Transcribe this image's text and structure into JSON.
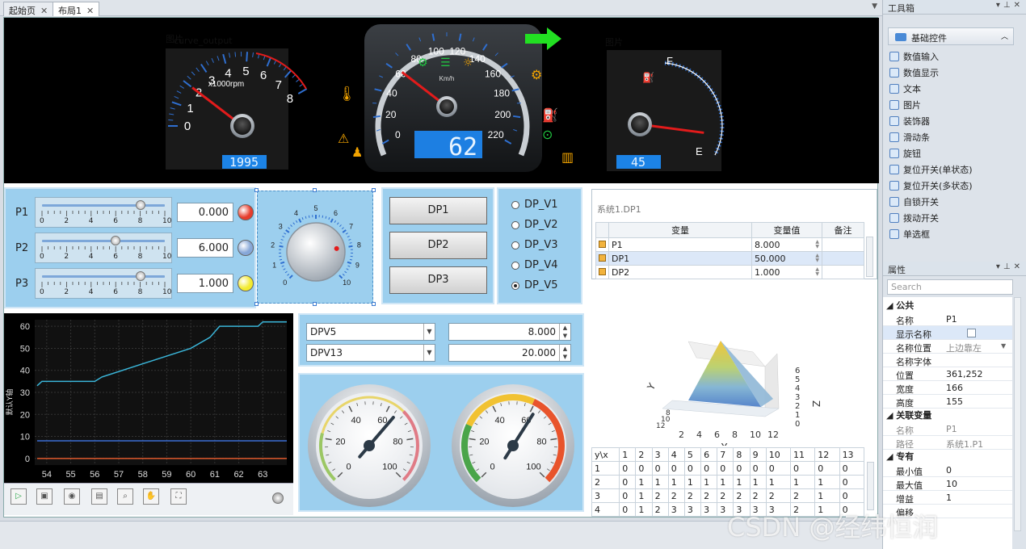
{
  "tabs": [
    {
      "label": "起始页",
      "active": false
    },
    {
      "label": "布局1",
      "active": true
    }
  ],
  "dashboard": {
    "tacho": {
      "title": "图片",
      "title2": "curve_output",
      "unit": "x1000rpm",
      "ticks": [
        "0",
        "1",
        "2",
        "3",
        "4",
        "5",
        "6",
        "7",
        "8"
      ],
      "digital": "1995",
      "needle_value": 2.0
    },
    "speedo": {
      "unit": "Km/h",
      "ticks": [
        "0",
        "20",
        "40",
        "60",
        "80",
        "100",
        "120",
        "140",
        "160",
        "180",
        "200",
        "220"
      ],
      "digital": "62",
      "needle_value": 62
    },
    "fuel": {
      "title": "图片",
      "full_label": "F",
      "empty_label": "E",
      "digital": "45",
      "needle_fraction": 0.25
    },
    "colors": {
      "tick_blue": "#2f6fd0",
      "digital_bg": "#1d7fe2",
      "arrow_green": "#22e022",
      "warn_orange": "#f3a400",
      "warn_red": "#ff2222",
      "indicator_green": "#21c441"
    }
  },
  "sliders": [
    {
      "label": "P1",
      "value": "0.000",
      "slider_fraction": 0.8,
      "led_color": "#e63c2c"
    },
    {
      "label": "P2",
      "value": "6.000",
      "slider_fraction": 0.6,
      "led_color": "#86a7d8"
    },
    {
      "label": "P3",
      "value": "1.000",
      "slider_fraction": 0.8,
      "led_color": "#f2ea2f"
    }
  ],
  "slider_ticks": [
    "0",
    "2",
    "4",
    "6",
    "8",
    "10"
  ],
  "knob": {
    "ticks": [
      "0",
      "1",
      "2",
      "3",
      "4",
      "5",
      "6",
      "7",
      "8",
      "9",
      "10"
    ],
    "value": 8.0
  },
  "buttons": [
    "DP1",
    "DP2",
    "DP3"
  ],
  "radios": [
    {
      "label": "DP_V1",
      "checked": false
    },
    {
      "label": "DP_V2",
      "checked": false
    },
    {
      "label": "DP_V3",
      "checked": false
    },
    {
      "label": "DP_V4",
      "checked": false
    },
    {
      "label": "DP_V5",
      "checked": true
    }
  ],
  "var_table": {
    "title": "系统1.DP1",
    "headers": [
      "变量",
      "变量值",
      "备注"
    ],
    "rows": [
      {
        "name": "P1",
        "value": "8.000",
        "note": ""
      },
      {
        "name": "DP1",
        "value": "50.000",
        "note": ""
      },
      {
        "name": "DP2",
        "value": "1.000",
        "note": ""
      }
    ]
  },
  "combos": [
    {
      "label": "DPV5",
      "value": "8.000"
    },
    {
      "label": "DPV13",
      "value": "20.000"
    }
  ],
  "meters": [
    {
      "ticks": [
        "0",
        "20",
        "40",
        "60",
        "80",
        "100"
      ],
      "value": 65
    },
    {
      "ticks": [
        "0",
        "20",
        "40",
        "60",
        "80",
        "100"
      ],
      "value": 62
    }
  ],
  "surface": {
    "ylabel": "Y",
    "xlabel": "X",
    "zlabel": "Z",
    "x_ticks": [
      "2",
      "4",
      "6",
      "8",
      "10",
      "12"
    ],
    "z_ticks": [
      "0",
      "1",
      "2",
      "3",
      "4",
      "5",
      "6"
    ],
    "y_ticks": [
      "12",
      "10",
      "8"
    ]
  },
  "data_grid": {
    "headers": [
      "y\\x",
      "1",
      "2",
      "3",
      "4",
      "5",
      "6",
      "7",
      "8",
      "9",
      "10",
      "11",
      "12",
      "13"
    ],
    "rows": [
      [
        "1",
        "0",
        "0",
        "0",
        "0",
        "0",
        "0",
        "0",
        "0",
        "0",
        "0",
        "0",
        "0",
        "0"
      ],
      [
        "2",
        "0",
        "1",
        "1",
        "1",
        "1",
        "1",
        "1",
        "1",
        "1",
        "1",
        "1",
        "1",
        "0"
      ],
      [
        "3",
        "0",
        "1",
        "2",
        "2",
        "2",
        "2",
        "2",
        "2",
        "2",
        "2",
        "2",
        "1",
        "0"
      ],
      [
        "4",
        "0",
        "1",
        "2",
        "3",
        "3",
        "3",
        "3",
        "3",
        "3",
        "3",
        "2",
        "1",
        "0"
      ]
    ]
  },
  "chart_data": {
    "type": "line",
    "title": "",
    "xlabel": "",
    "ylabel": "默认Y轴",
    "xlim": [
      53.5,
      64
    ],
    "ylim": [
      -3,
      63
    ],
    "x_ticks": [
      "54",
      "55",
      "56",
      "57",
      "58",
      "59",
      "60",
      "61",
      "62",
      "63"
    ],
    "y_ticks": [
      "0",
      "10",
      "20",
      "30",
      "40",
      "50",
      "60"
    ],
    "grid": true,
    "series": [
      {
        "color": "#3ab5d8",
        "x": [
          53.6,
          53.8,
          56.0,
          56.3,
          58.0,
          60.0,
          60.8,
          61.2,
          62.8,
          63.0,
          64.0
        ],
        "y": [
          33,
          35,
          35,
          37,
          43,
          50,
          55,
          60,
          60,
          62,
          62
        ]
      },
      {
        "color": "#3a6fd6",
        "x": [
          53.6,
          64.0
        ],
        "y": [
          8,
          8
        ]
      },
      {
        "color": "#e05a2c",
        "x": [
          53.6,
          64.0
        ],
        "y": [
          0,
          0
        ]
      }
    ]
  },
  "chart_toolbar": [
    "play-icon",
    "save-icon",
    "eye-icon",
    "chart-icon",
    "zoom-icon",
    "pan-icon",
    "fullscreen-icon"
  ],
  "toolbox": {
    "title": "工具箱",
    "group": "基础控件",
    "items": [
      "数值输入",
      "数值显示",
      "文本",
      "图片",
      "装饰器",
      "滑动条",
      "旋钮",
      "复位开关(单状态)",
      "复位开关(多状态)",
      "自锁开关",
      "拨动开关",
      "单选框"
    ]
  },
  "props": {
    "title": "属性",
    "search_placeholder": "Search",
    "sections": [
      {
        "name": "公共",
        "rows": [
          {
            "k": "名称",
            "v": "P1"
          },
          {
            "k": "显示名称",
            "v": ""
          },
          {
            "k": "名称位置",
            "v": "上边靠左"
          },
          {
            "k": "名称字体",
            "v": ""
          },
          {
            "k": "位置",
            "v": "361,252"
          },
          {
            "k": "宽度",
            "v": "166"
          },
          {
            "k": "高度",
            "v": "155"
          }
        ]
      },
      {
        "name": "关联变量",
        "rows": [
          {
            "k": "名称",
            "v": "P1"
          },
          {
            "k": "路径",
            "v": "系统1.P1"
          }
        ]
      },
      {
        "name": "专有",
        "rows": [
          {
            "k": "最小值",
            "v": "0"
          },
          {
            "k": "最大值",
            "v": "10"
          },
          {
            "k": "增益",
            "v": "1"
          },
          {
            "k": "偏移",
            "v": ""
          }
        ]
      }
    ]
  },
  "watermark": "CSDN @经纬恒润"
}
